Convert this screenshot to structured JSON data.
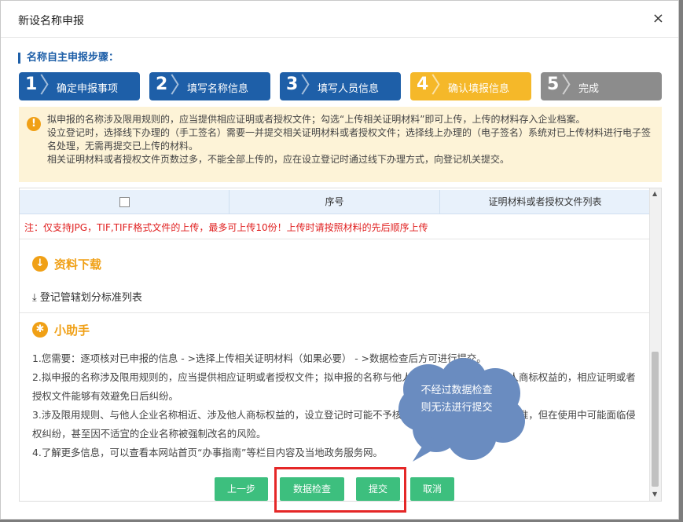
{
  "dialog": {
    "title": "新设名称申报",
    "close": "×"
  },
  "steps_title": "名称自主申报步骤：",
  "steps": [
    {
      "num": "1",
      "label": "确定申报事项",
      "status": "done",
      "color": "#1e5fa8"
    },
    {
      "num": "2",
      "label": "填写名称信息",
      "status": "done",
      "color": "#1e5fa8"
    },
    {
      "num": "3",
      "label": "填写人员信息",
      "status": "done",
      "color": "#1e5fa8"
    },
    {
      "num": "4",
      "label": "确认填报信息",
      "status": "current",
      "color": "#f5b829"
    },
    {
      "num": "5",
      "label": "完成",
      "status": "pending",
      "color": "#8c8c8c"
    }
  ],
  "notice": {
    "icon": "!",
    "lines": [
      "拟申报的名称涉及限用规则的，应当提供相应证明或者授权文件；勾选“上传相关证明材料”即可上传，上传的材料存入企业档案。",
      "设立登记时，选择线下办理的（手工签名）需要一并提交相关证明材料或者授权文件；选择线上办理的（电子签名）系统对已上传材料进行电子签名处理，无需再提交已上传的材料。",
      "相关证明材料或者授权文件页数过多，不能全部上传的，应在设立登记时通过线下办理方式，向登记机关提交。"
    ]
  },
  "table": {
    "headers": [
      "",
      "序号",
      "证明材料或者授权文件列表"
    ]
  },
  "upload_note": "注：仅支持JPG，TIF,TIFF格式文件的上传，最多可上传10份！上传时请按照材料的先后顺序上传",
  "download_section": {
    "title": "资料下载",
    "link": "登记管辖划分标准列表"
  },
  "helper_section": {
    "title": "小助手",
    "text": "1.您需要：逐项核对已申报的信息 - >选择上传相关证明材料（如果必要） - >数据检查后方可进行提交。\n2.拟申报的名称涉及限用规则的，应当提供相应证明或者授权文件；拟申报的名称与他人企业名称相近、涉及他人商标权益的，相应证明或者授权文件能够有效避免日后纠纷。\n3.涉及限用规则、与他人企业名称相近、涉及他人商标权益的，设立登记时可能不予核准，即使设立登记时予以核准，但在使用中可能面临侵权纠纷，甚至因不适宜的企业名称被强制改名的风险。\n4.了解更多信息，可以查看本网站首页“办事指南”等栏目内容及当地政务服务网。"
  },
  "buttons": {
    "prev": "上一步",
    "check": "数据检查",
    "submit": "提交",
    "cancel": "取消"
  },
  "callout": {
    "text": "不经过数据检查则无法进行提交",
    "line1": "不经过数据检查",
    "line2": "则无法进行提交",
    "color": "#6a8cc0"
  },
  "colors": {
    "primary": "#1e5fa8",
    "accent": "#f0a016",
    "button": "#3dbf7e",
    "warning": "#e02020"
  }
}
